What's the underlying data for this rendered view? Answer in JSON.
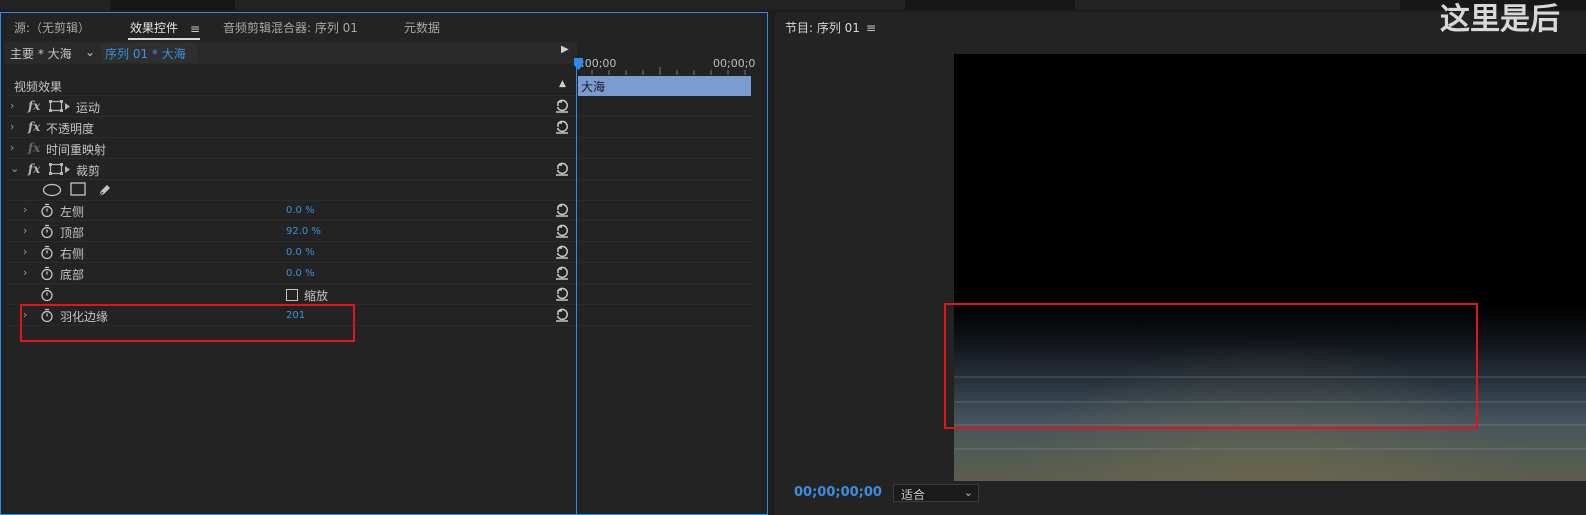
{
  "overlay_text": "这里是后",
  "left_panel": {
    "tabs": {
      "source": "源:（无剪辑）",
      "effect_controls": "效果控件",
      "audio_mixer": "音频剪辑混合器: 序列 01",
      "metadata": "元数据"
    },
    "source_bar": {
      "master": "主要 * 大海",
      "sequence": "序列 01 * 大海",
      "timecode_start": ":00;00",
      "timecode_end": "00;00;0"
    },
    "clip_name": "大海",
    "section_title": "视频效果",
    "effects": [
      {
        "name": "运动"
      },
      {
        "name": "不透明度"
      },
      {
        "name": "时间重映射"
      },
      {
        "name": "裁剪"
      }
    ],
    "crop_params": [
      {
        "name": "左侧",
        "value": "0.0 %"
      },
      {
        "name": "顶部",
        "value": "92.0 %"
      },
      {
        "name": "右侧",
        "value": "0.0 %"
      },
      {
        "name": "底部",
        "value": "0.0 %"
      }
    ],
    "zoom_label": "缩放",
    "feather": {
      "name": "羽化边缘",
      "value": "201"
    }
  },
  "right_panel": {
    "title": "节目: 序列 01",
    "timecode": "00;00;00;00",
    "fit_label": "适合"
  },
  "colors": {
    "accent_blue": "#2d8ceb",
    "value_blue": "#3a8fe0",
    "highlight_red": "#e0141b",
    "clip_fill": "#7a9ccf"
  }
}
